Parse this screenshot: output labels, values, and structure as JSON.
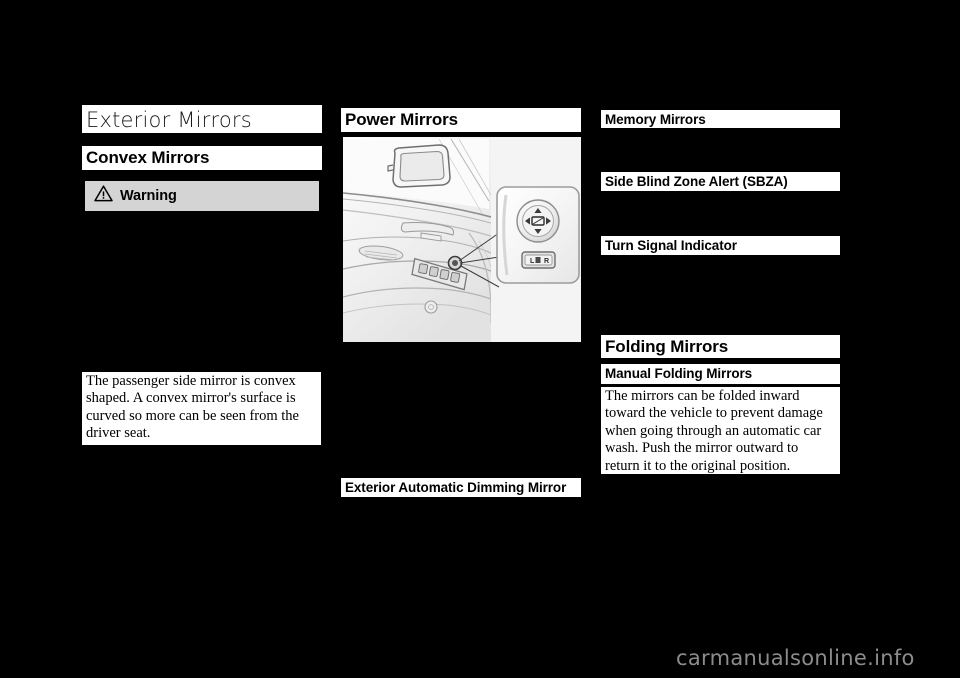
{
  "page": {
    "background_color": "#000000",
    "text_block_color": "#ffffff",
    "warning_box_color": "#d4d4d4",
    "watermark_color": "#8c8c8c"
  },
  "column1": {
    "chapter_title": "Exterior Mirrors",
    "section_heading": "Convex Mirrors",
    "warning": {
      "icon": "warning-triangle-icon",
      "label": "Warning"
    },
    "body_paragraph": "The passenger side mirror is convex shaped. A convex mirror's surface is curved so more can be seen from the driver seat."
  },
  "column2": {
    "section_heading": "Power Mirrors",
    "figure": {
      "name": "power-mirror-door-switch-illustration",
      "description": "Driver door panel with mirror control switch and magnified callout",
      "callout": {
        "adjust_knob": "mirror-adjust-directional-knob",
        "selector_switch_label": "L  R"
      }
    },
    "caption_heading": "Exterior Automatic Dimming Mirror"
  },
  "column3": {
    "heading_memory": "Memory Mirrors",
    "heading_sbza": "Side Blind Zone Alert (SBZA)",
    "heading_turn_signal": "Turn Signal Indicator",
    "heading_folding": "Folding Mirrors",
    "heading_manual_folding": "Manual Folding Mirrors",
    "body_paragraph": "The mirrors can be folded inward toward the vehicle to prevent damage when going through an automatic car wash. Push the mirror outward to return it to the original position."
  },
  "footer": {
    "watermark": "carmanualsonline.info"
  }
}
